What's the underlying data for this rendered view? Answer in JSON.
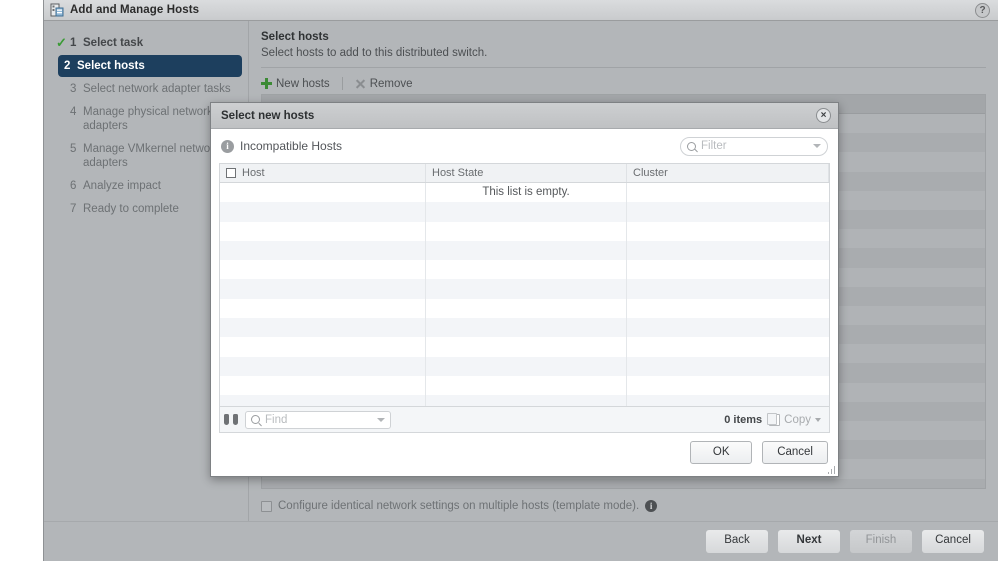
{
  "window": {
    "title": "Add and Manage Hosts",
    "icon": "hosts-window-icon",
    "help_icon": "?"
  },
  "sidebar": {
    "steps": [
      {
        "num": "1",
        "label": "Select task",
        "state": "done",
        "check": "✓"
      },
      {
        "num": "2",
        "label": "Select hosts",
        "state": "current",
        "check": ""
      },
      {
        "num": "3",
        "label": "Select network adapter tasks",
        "state": "pending",
        "check": ""
      },
      {
        "num": "4",
        "label": "Manage physical network adapters",
        "state": "pending",
        "check": ""
      },
      {
        "num": "5",
        "label": "Manage VMkernel network adapters",
        "state": "pending",
        "check": ""
      },
      {
        "num": "6",
        "label": "Analyze impact",
        "state": "pending",
        "check": ""
      },
      {
        "num": "7",
        "label": "Ready to complete",
        "state": "pending",
        "check": ""
      }
    ]
  },
  "main": {
    "heading": "Select hosts",
    "subheading": "Select hosts to add to this distributed switch.",
    "toolbar": {
      "new_hosts": "New hosts",
      "remove": "Remove"
    },
    "template_mode": {
      "label": "Configure identical network settings on multiple hosts (template mode).",
      "checked": false
    }
  },
  "footer": {
    "back": "Back",
    "next": "Next",
    "finish": "Finish",
    "cancel": "Cancel"
  },
  "modal": {
    "title": "Select new hosts",
    "close": "×",
    "category_label": "Incompatible Hosts",
    "filter": {
      "placeholder": "Filter",
      "value": ""
    },
    "table": {
      "columns": [
        "Host",
        "Host State",
        "Cluster"
      ],
      "rows": [],
      "empty_message": "This list is empty."
    },
    "list_footer": {
      "find_placeholder": "Find",
      "item_count": "0 items",
      "copy": "Copy"
    },
    "buttons": {
      "ok": "OK",
      "cancel": "Cancel"
    }
  },
  "colors": {
    "accent": "#1d3f5e",
    "check_green": "#3a9b35",
    "chrome": "#b3b6b9"
  }
}
